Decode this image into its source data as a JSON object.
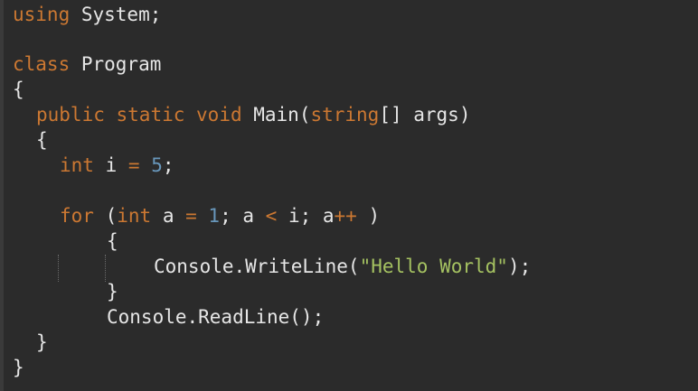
{
  "code": {
    "l1": {
      "kw": "using",
      "rest": " System;"
    },
    "l2": {
      "kw": "class",
      "rest": " Program"
    },
    "l3": {
      "brace": "{"
    },
    "l4": {
      "kw1": "public",
      "kw2": "static",
      "kw3": "void",
      "main": " Main(",
      "type": "string",
      "rest": "[] args)"
    },
    "l5": {
      "brace": "{"
    },
    "l6": {
      "kw": "int",
      "id": " i ",
      "op": "=",
      "sp": " ",
      "num": "5",
      "end": ";"
    },
    "l7": {
      "kw": "for",
      "p1": " (",
      "kw2": "int",
      "id": " a ",
      "op1": "=",
      "sp": " ",
      "num": "1",
      "mid": "; a ",
      "op2": "<",
      "mid2": " i; a",
      "op3": "++",
      "end": " )"
    },
    "l8": {
      "brace": "{"
    },
    "l9": {
      "call": "Console.WriteLine(",
      "str": "\"Hello World\"",
      "end": ");"
    },
    "l10": {
      "brace": "}"
    },
    "l11": {
      "call": "Console.ReadLine();"
    },
    "l12": {
      "brace": "}"
    },
    "l13": {
      "brace": "}"
    }
  }
}
